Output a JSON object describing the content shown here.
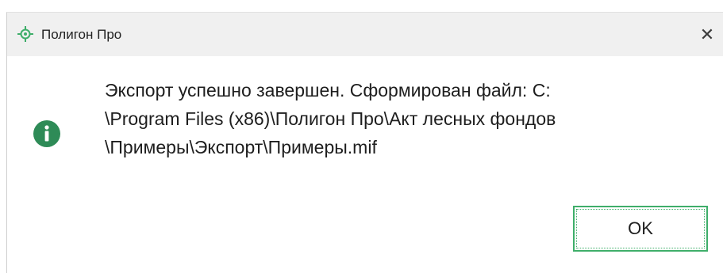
{
  "window": {
    "title": "Полигон Про",
    "app_icon": "crosshair-locator-icon",
    "close_icon": "close-icon",
    "close_label": "✕"
  },
  "message": {
    "icon": "info-icon",
    "lines": [
      "Экспорт успешно завершен. Сформирован файл: C:",
      "\\Program Files (x86)\\Полигон Про\\Акт лесных фондов",
      "\\Примеры\\Экспорт\\Примеры.mif"
    ]
  },
  "buttons": {
    "ok_label": "OK"
  },
  "colors": {
    "accent": "#3fae6a",
    "titlebar_bg": "#f0f0f0",
    "icon_green": "#2e8b57"
  }
}
